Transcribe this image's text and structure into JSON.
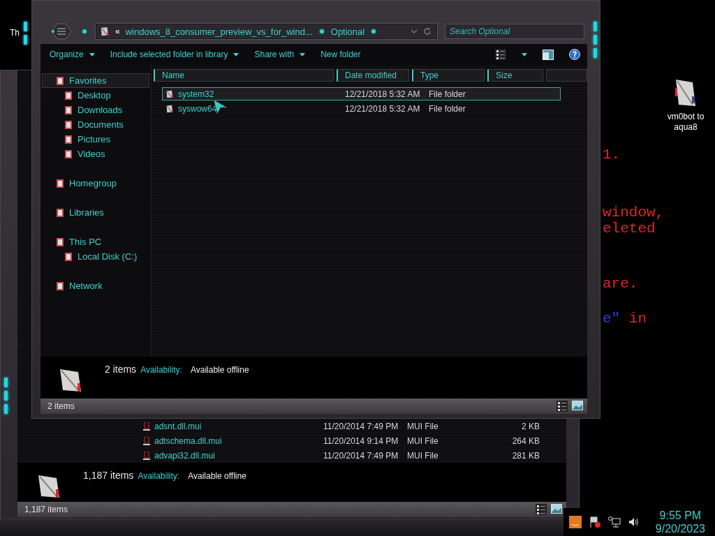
{
  "desktop": {
    "icon_labels": [
      "Th",
      "vm0bot to aqua8"
    ],
    "background_text": [
      {
        "parts": [
          {
            "text": "1.",
            "color": "#e0242c"
          }
        ]
      },
      {
        "parts": [
          {
            "text": "window,",
            "color": "#e0242c"
          }
        ]
      },
      {
        "parts": [
          {
            "text": "eleted",
            "color": "#e0242c"
          }
        ]
      },
      {
        "parts": [
          {
            "text": "are.",
            "color": "#e0242c"
          }
        ]
      },
      {
        "parts": [
          {
            "text": "e\"",
            "color": "#3340d0"
          },
          {
            "text": " in",
            "color": "#e0242c"
          }
        ]
      }
    ]
  },
  "back_window": {
    "files": [
      {
        "name": "adsnt.dll.mui",
        "date": "11/20/2014 7:49 PM",
        "type": "MUI File",
        "size": "2 KB"
      },
      {
        "name": "adtschema.dll.mui",
        "date": "11/20/2014 9:14 PM",
        "type": "MUI File",
        "size": "264 KB"
      },
      {
        "name": "advapi32.dll.mui",
        "date": "11/20/2014 7:49 PM",
        "type": "MUI File",
        "size": "281 KB"
      }
    ],
    "details": {
      "count": "1,187 items",
      "label": "Availability:",
      "value": "Available offline"
    },
    "status": "1,187 items"
  },
  "front_window": {
    "address": {
      "chevron": "«",
      "crumbs": [
        "windows_8_consumer_preview_vs_for_wind...",
        "Optional"
      ]
    },
    "search": {
      "placeholder": "Search Optional"
    },
    "toolbar": [
      {
        "label": "Organize",
        "dropdown": true
      },
      {
        "label": "Include selected folder in library",
        "dropdown": true
      },
      {
        "label": "Share with",
        "dropdown": true
      },
      {
        "label": "New folder",
        "dropdown": false
      }
    ],
    "nav": [
      {
        "label": "Favorites",
        "selected": true,
        "children": [
          {
            "label": "Desktop",
            "selected": false
          },
          {
            "label": "Downloads",
            "selected": false
          },
          {
            "label": "Documents",
            "selected": false
          },
          {
            "label": "Pictures",
            "selected": false
          },
          {
            "label": "Videos",
            "selected": false
          }
        ]
      },
      {
        "label": "Homegroup",
        "selected": false
      },
      {
        "label": "Libraries",
        "selected": false
      },
      {
        "label": "This PC",
        "selected": false,
        "children": [
          {
            "label": "Local Disk (C:)",
            "selected": false
          }
        ]
      },
      {
        "label": "Network",
        "selected": false
      }
    ],
    "columns": [
      "Name",
      "Date modified",
      "Type",
      "Size"
    ],
    "rows": [
      {
        "name": "system32",
        "date": "12/21/2018 5:32 AM",
        "type": "File folder",
        "selected": true
      },
      {
        "name": "syswow64",
        "date": "12/21/2018 5:32 AM",
        "type": "File folder",
        "selected": false
      }
    ],
    "details": {
      "count": "2 items",
      "label": "Availability:",
      "value": "Available offline"
    },
    "status": "2 items"
  },
  "taskbar": {
    "time": "9:55 PM",
    "date": "9/20/2023"
  }
}
